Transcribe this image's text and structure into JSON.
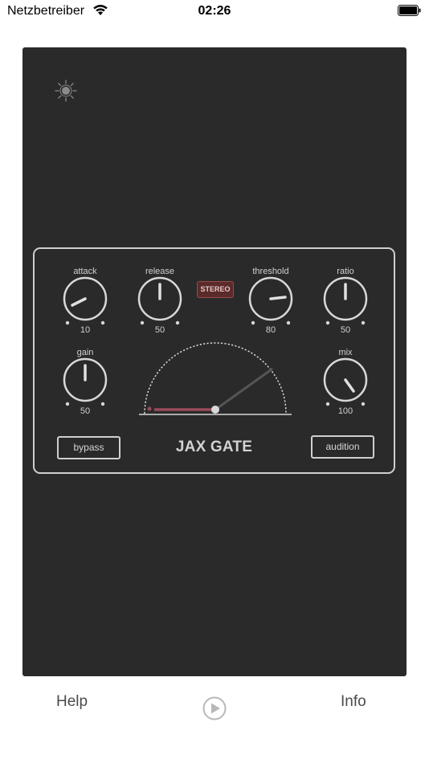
{
  "status_bar": {
    "carrier": "Netzbetreiber",
    "time": "02:26"
  },
  "plugin": {
    "name": "JAX GATE",
    "stereo_label": "STEREO",
    "knobs": {
      "attack": {
        "label": "attack",
        "value": "10"
      },
      "release": {
        "label": "release",
        "value": "50"
      },
      "threshold": {
        "label": "threshold",
        "value": "80"
      },
      "ratio": {
        "label": "ratio",
        "value": "50"
      },
      "gain": {
        "label": "gain",
        "value": "50"
      },
      "mix": {
        "label": "mix",
        "value": "100"
      }
    },
    "bypass_label": "bypass",
    "audition_label": "audition",
    "colors": {
      "panel": "#2a2a2a",
      "accent": "#9a4a5a",
      "stereo_bg": "#5b2a2a"
    }
  },
  "bottom_bar": {
    "help_label": "Help",
    "info_label": "Info",
    "play_icon": "play-icon"
  }
}
